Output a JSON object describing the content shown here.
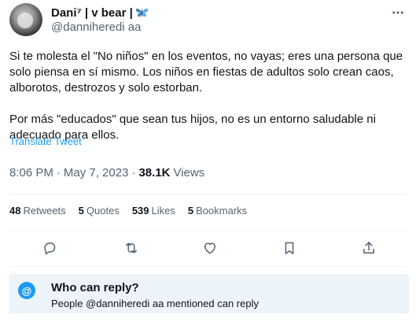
{
  "author": {
    "display_name": "Dani⁷ | v bear |",
    "handle": "@danniheredi aa",
    "emoji_icon": "butterfly-icon"
  },
  "tweet": {
    "text": "Si te molesta el \"No niños\" en los eventos, no vayas; eres una persona que solo piensa en sí mismo. Los niños en fiestas de adultos solo crean caos, alborotos, destrozos y solo estorban.\n\nPor más \"educados\" que sean tus hijos, no es un entorno saludable ni adecuado para ellos.",
    "translate_label": "Translate Tweet"
  },
  "meta": {
    "time": "8:06 PM",
    "separator": "·",
    "date": "May 7, 2023",
    "views_count": "38.1K",
    "views_label": "Views"
  },
  "stats": {
    "retweets_count": "48",
    "retweets_label": "Retweets",
    "quotes_count": "5",
    "quotes_label": "Quotes",
    "likes_count": "539",
    "likes_label": "Likes",
    "bookmarks_count": "5",
    "bookmarks_label": "Bookmarks"
  },
  "reply_restriction": {
    "icon_glyph": "@",
    "title": "Who can reply?",
    "subtitle": "People @danniheredi aa mentioned can reply"
  },
  "colors": {
    "accent": "#1d9bf0",
    "secondary_text": "#536471",
    "reply_box_bg": "#ecf4fa"
  }
}
